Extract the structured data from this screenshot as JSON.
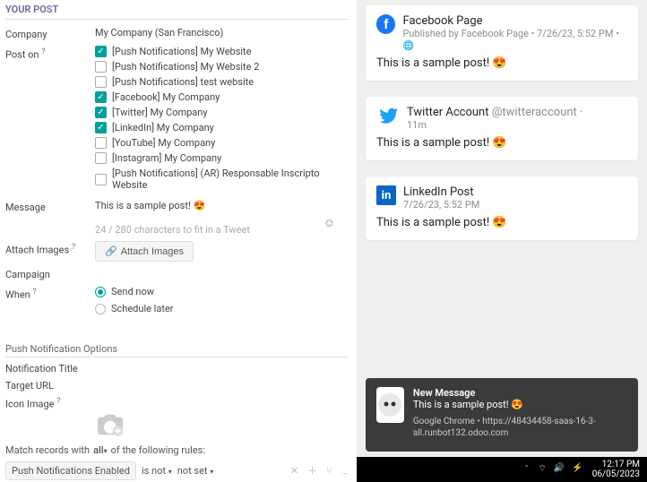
{
  "form": {
    "section_title": "YOUR POST",
    "company_label": "Company",
    "company_value": "My Company (San Francisco)",
    "post_on_label": "Post on",
    "channels": [
      {
        "label": "[Push Notifications] My Website",
        "checked": true
      },
      {
        "label": "[Push Notifications] My Website 2",
        "checked": false
      },
      {
        "label": "[Push Notifications] test website",
        "checked": false
      },
      {
        "label": "[Facebook] My Company",
        "checked": true
      },
      {
        "label": "[Twitter] My Company",
        "checked": true
      },
      {
        "label": "[LinkedIn] My Company",
        "checked": true
      },
      {
        "label": "[YouTube] My Company",
        "checked": false
      },
      {
        "label": "[Instagram] My Company",
        "checked": false
      },
      {
        "label": "[Push Notifications] (AR) Responsable Inscripto Website",
        "checked": false
      }
    ],
    "message_label": "Message",
    "message_value": "This is a sample post!  😍",
    "char_count": "24 / 280 characters to fit in a Tweet",
    "attach_images_label": "Attach Images",
    "attach_button": "Attach Images",
    "campaign_label": "Campaign",
    "when_label": "When",
    "when_options": {
      "now": "Send now",
      "later": "Schedule later"
    },
    "push_section": "Push Notification Options",
    "notification_title_label": "Notification Title",
    "target_url_label": "Target URL",
    "icon_image_label": "Icon Image",
    "match_prefix": "Match records with",
    "match_mode": "all",
    "match_suffix": "of the following rules:",
    "rule_field": "Push Notifications Enabled",
    "rule_op": "is not",
    "rule_val": "not set"
  },
  "previews": {
    "facebook": {
      "title": "Facebook Page",
      "subtitle": "Published by Facebook Page • 7/26/23, 5:52 PM •",
      "body": "This is a sample post!  😍"
    },
    "twitter": {
      "title": "Twitter Account",
      "handle": "@twitteraccount ·",
      "time": "11m",
      "body": "This is a sample post!  😍"
    },
    "linkedin": {
      "title": "LinkedIn Post",
      "subtitle": "7/26/23, 5:52 PM",
      "body": "This is a sample post!  😍"
    },
    "notification": {
      "title": "New Message",
      "body": "This is a sample post!  😍",
      "source": "Google Chrome • https://48434458-saas-16-3-all.runbot132.odoo.com"
    }
  },
  "taskbar": {
    "time": "12:17 PM",
    "date": "06/05/2023"
  }
}
